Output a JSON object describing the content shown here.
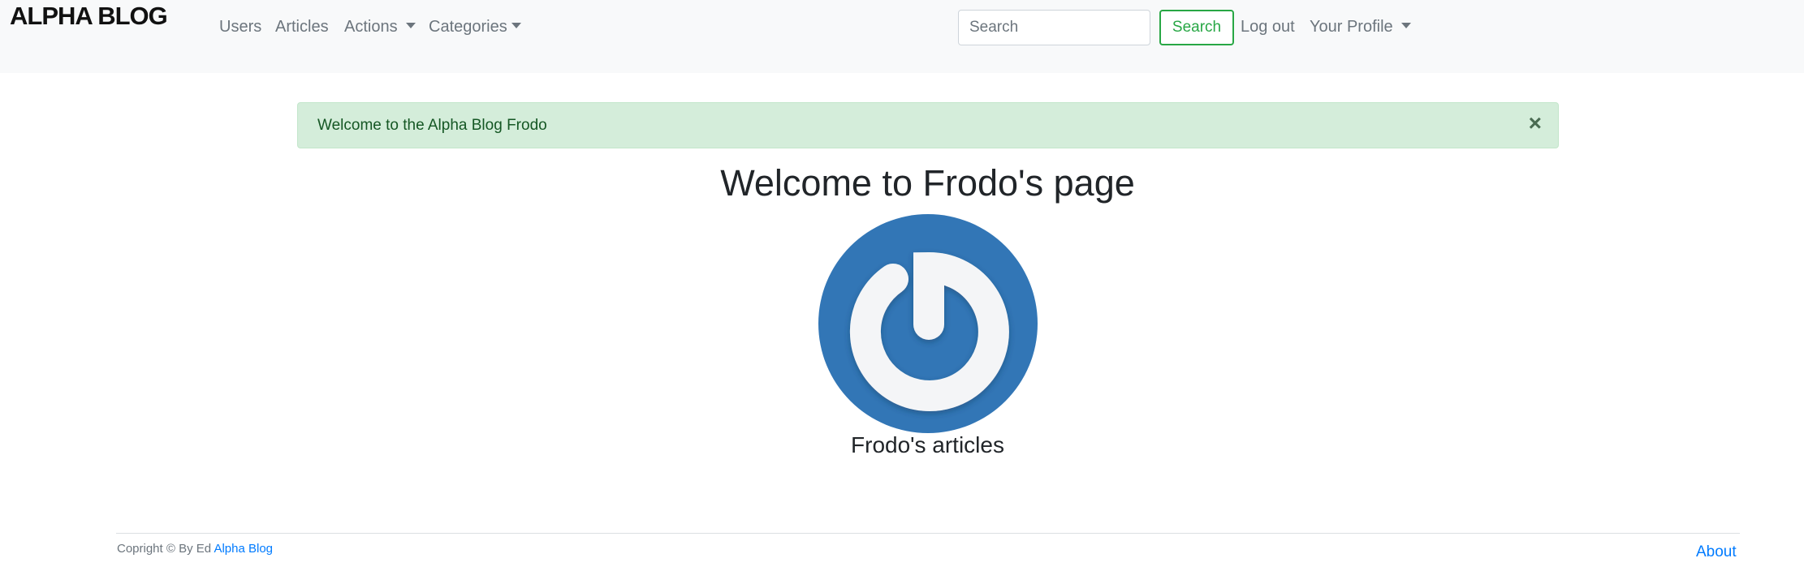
{
  "navbar": {
    "brand": "ALPHA BLOG",
    "users": "Users",
    "articles": "Articles",
    "actions": "Actions",
    "categories": "Categories",
    "search_placeholder": "Search",
    "search_button": "Search",
    "logout": "Log out",
    "profile": "Your Profile"
  },
  "alert": {
    "message": "Welcome to the Alpha Blog Frodo",
    "close": "×"
  },
  "main": {
    "title": "Welcome to Frodo's page",
    "articles_heading": "Frodo's articles"
  },
  "footer": {
    "copyright": "Copright © By Ed ",
    "link_text": "Alpha Blog",
    "about": "About"
  },
  "colors": {
    "navbar_bg": "#f8f9fa",
    "alert_bg": "#d4edda",
    "alert_text": "#155724",
    "success": "#28a745",
    "avatar_bg": "#3276b6",
    "link": "#007bff"
  }
}
